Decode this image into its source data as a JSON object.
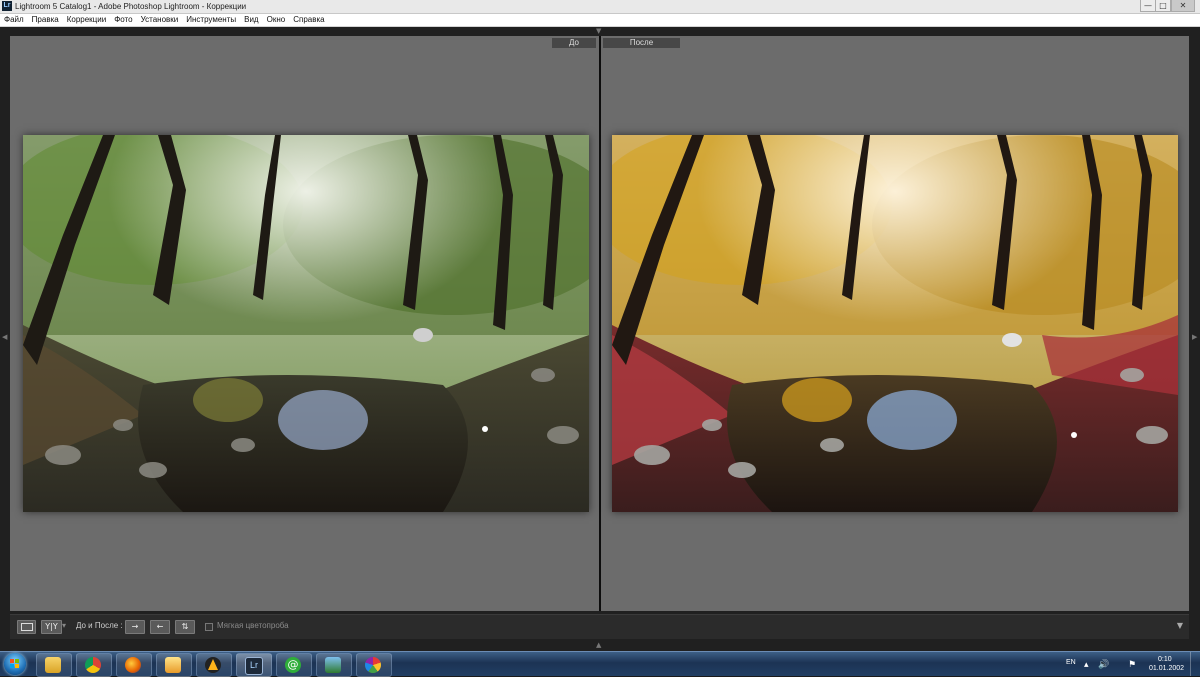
{
  "window": {
    "title": "Lightroom 5 Catalog1 - Adobe Photoshop Lightroom - Коррекции",
    "app_icon": "Lr",
    "controls": {
      "minimize": "—",
      "maximize": "□",
      "close": "✕"
    }
  },
  "menu": [
    "Файл",
    "Правка",
    "Коррекции",
    "Фото",
    "Установки",
    "Инструменты",
    "Вид",
    "Окно",
    "Справка"
  ],
  "view": {
    "before_label": "До",
    "after_label": "После"
  },
  "toolbar": {
    "view_mode_label": "До и После :",
    "yy_label": "Y|Y",
    "swap_buttons": [
      "→",
      "←",
      "⇅"
    ],
    "soft_proof_label": "Мягкая цветопроба",
    "soft_proof_checked": false
  },
  "taskbar": {
    "apps": [
      "file-explorer-icon",
      "chrome-icon",
      "firefox-icon",
      "media-player-icon",
      "aimp-icon",
      "lightroom-icon",
      "mail-agent-icon",
      "photo-viewer-icon",
      "picasa-icon"
    ],
    "active_app": "lightroom-icon",
    "lightroom_label": "Lr",
    "language": "EN",
    "time": "0:10",
    "date": "01.01.2002"
  },
  "colors": {
    "pane_bg": "#6c6c6c",
    "toolbar_bg": "#2b2b2b",
    "taskbar_bg": "#1c3354"
  }
}
